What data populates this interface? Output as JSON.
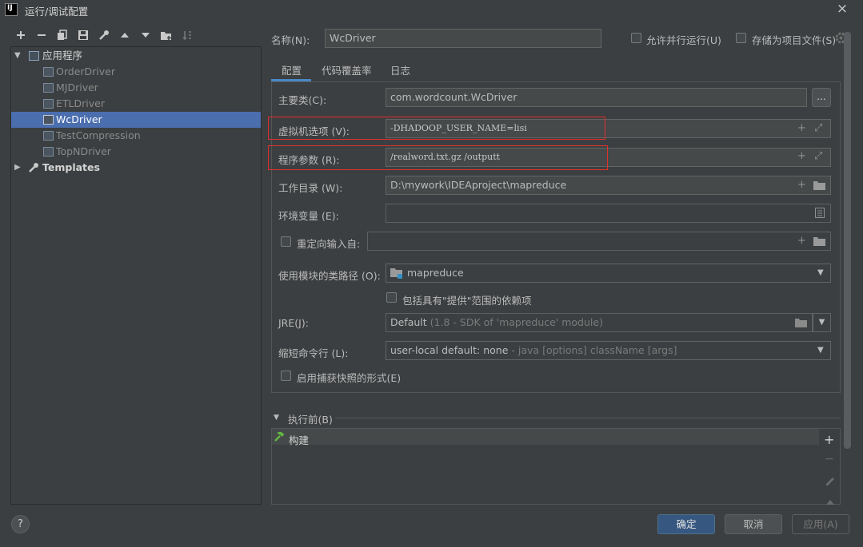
{
  "window": {
    "app_icon": "IJ",
    "title": "运行/调试配置",
    "close": "×"
  },
  "toolbar": [
    "add-icon",
    "remove-icon",
    "copy-icon",
    "save-icon",
    "wrench-icon",
    "move-up-icon",
    "move-down-icon",
    "new-folder-icon",
    "sort-icon"
  ],
  "tree": {
    "root_label": "应用程序",
    "items": [
      "OrderDriver",
      "MJDriver",
      "ETLDriver",
      "WcDriver",
      "TestCompression",
      "TopNDriver"
    ],
    "selected": "WcDriver",
    "templates_label": "Templates"
  },
  "header": {
    "name_label": "名称(N):",
    "name_value": "WcDriver",
    "allow_parallel_label": "允许并行运行(U)",
    "store_as_project_label": "存储为项目文件(S)"
  },
  "tabs": [
    "配置",
    "代码覆盖率",
    "日志"
  ],
  "form": {
    "main_class_label": "主要类(C):",
    "main_class_value": "com.wordcount.WcDriver",
    "browse": "...",
    "vm_options_label": "虚拟机选项 (V):",
    "vm_options_value": "-DHADOOP_USER_NAME=lisi",
    "program_args_label": "程序参数 (R):",
    "program_args_value": "/realword.txt.gz  /outputt",
    "working_dir_label": "工作目录 (W):",
    "working_dir_value": "D:\\mywork\\IDEAproject\\mapreduce",
    "env_vars_label": "环境变量 (E):",
    "env_vars_value": "",
    "redirect_input_label": "重定向输入自:",
    "classpath_label": "使用模块的类路径 (O):",
    "classpath_value": "mapreduce",
    "include_provided_label": "包括具有\"提供\"范围的依赖项",
    "jre_label": "JRE(J):",
    "jre_value": "Default",
    "jre_hint": "(1.8 - SDK of 'mapreduce' module)",
    "shorten_label": "缩短命令行 (L):",
    "shorten_value": "user-local default: none",
    "shorten_hint": "- java [options] className [args]",
    "snapshot_label": "启用捕获快照的形式(E)"
  },
  "before_launch": {
    "title": "执行前(B)",
    "items": [
      "构建"
    ]
  },
  "footer": {
    "help": "?",
    "ok": "确定",
    "cancel": "取消",
    "apply": "应用(A)"
  },
  "colors": {
    "selection": "#4b6eaf",
    "highlight_box": "#e0302c",
    "primary_button": "#365880"
  }
}
